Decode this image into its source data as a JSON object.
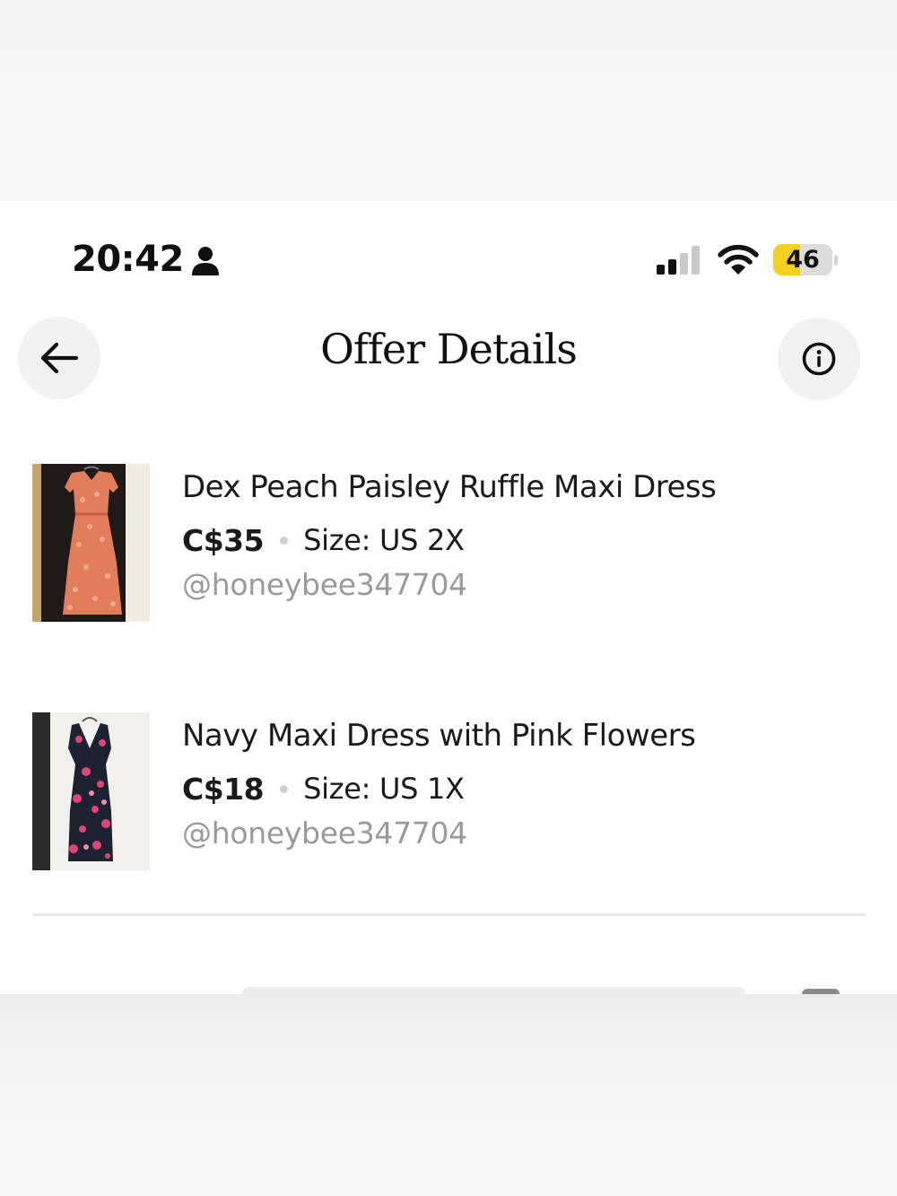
{
  "status_bar": {
    "time": "20:42",
    "battery_level": 46,
    "battery_label": "46",
    "signal_bars": 2,
    "signal_bars_total": 4,
    "icons": [
      "person-icon",
      "cellular-signal-icon",
      "wifi-icon",
      "battery-icon"
    ],
    "battery_color": "#f4cf22"
  },
  "header": {
    "title": "Offer Details",
    "back_icon": "arrow-left-icon",
    "info_icon": "info-circle-icon"
  },
  "items": [
    {
      "title": "Dex Peach Paisley Ruffle Maxi Dress",
      "price": "C$35",
      "size": "Size: US 2X",
      "seller": "@honeybee347704",
      "thumbnail": "peach-paisley-dress-photo"
    },
    {
      "title": "Navy Maxi Dress with Pink Flowers",
      "price": "C$18",
      "size": "Size: US 1X",
      "seller": "@honeybee347704",
      "thumbnail": "navy-floral-dress-photo"
    }
  ]
}
